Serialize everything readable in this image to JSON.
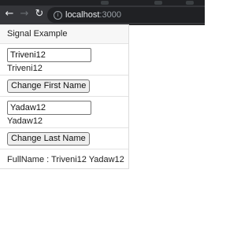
{
  "browser": {
    "url_host": "localhost",
    "url_port": ":3000",
    "icons": {
      "back": "arrow-left-icon",
      "forward": "arrow-right-icon",
      "reload": "reload-icon",
      "info": "info-icon"
    }
  },
  "app": {
    "title": "Signal Example",
    "first_name": {
      "input_value": "Triveni12",
      "echo": "Triveni12",
      "button_label": "Change First Name"
    },
    "last_name": {
      "input_value": "Yadaw12",
      "echo": "Yadaw12",
      "button_label": "Change Last Name"
    },
    "fullname_text": "FullName : Triveni12 Yadaw12"
  }
}
